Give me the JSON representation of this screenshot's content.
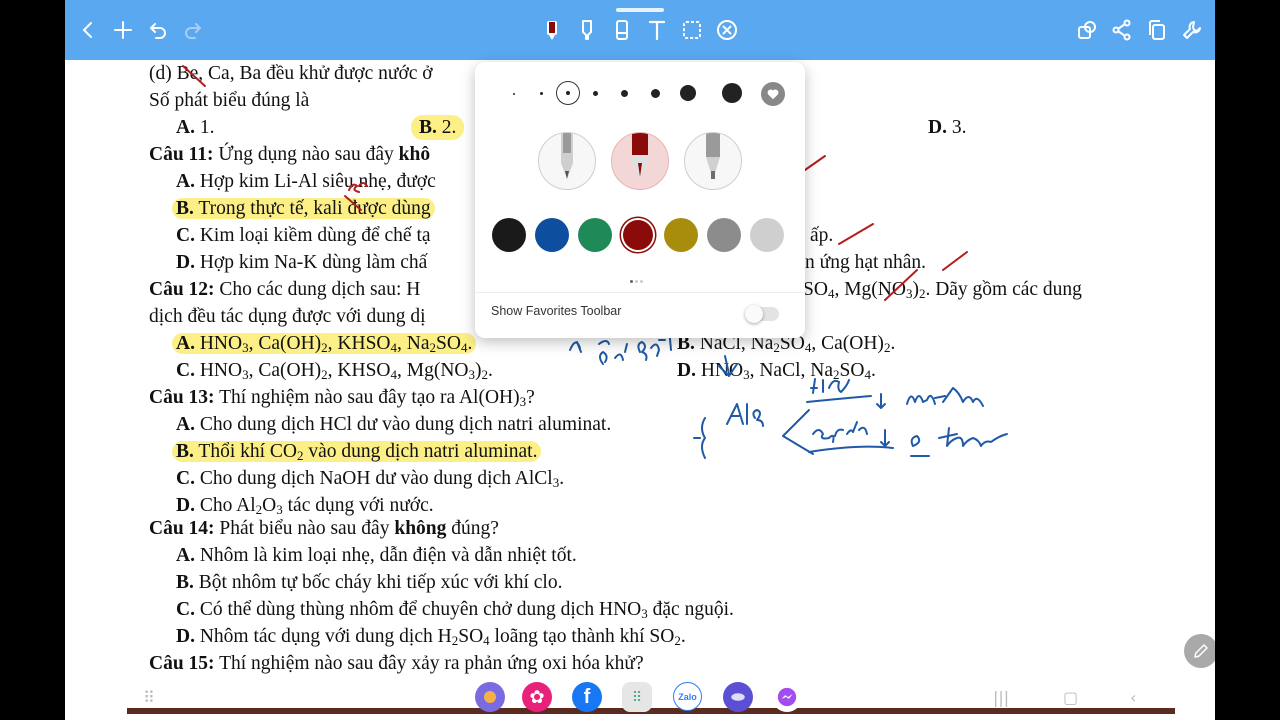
{
  "toolbar": {
    "left_icons": [
      "back-icon",
      "add-icon",
      "undo-icon",
      "redo-icon"
    ],
    "center_icons": [
      "pen-icon",
      "highlighter-icon",
      "eraser-icon",
      "text-icon",
      "lasso-icon",
      "close-circle-icon"
    ],
    "right_icons": [
      "shapes-icon",
      "share-icon",
      "copy-icon",
      "settings-wrench-icon"
    ],
    "accent": "#5aa8ef"
  },
  "doc": {
    "line1": {
      "prefix": "(d) ",
      "struck": "Be",
      ", rest": "",
      "text": ", Ca, Ba đều khử được nước ở"
    },
    "line2": "Số phát biểu đúng là",
    "q10": {
      "a_lbl": "A.",
      "a": "1.",
      "b_lbl": "B.",
      "b": "2.",
      "d_lbl": "D.",
      "d": "3."
    },
    "q11": {
      "label": "Câu 11:",
      "stem": "Ứng dụng nào sau đây",
      "stem_bold": "khô",
      "a_lbl": "A.",
      "a": "Hợp kim Li-Al siêu nhẹ, được",
      "b_lbl": "B.",
      "b": "Trong thực tế, kali được dùng",
      "c_lbl": "C.",
      "c": "Kim loại kiềm dùng để chế tạ",
      "c_tail": "ấp.",
      "d_lbl": "D.",
      "d": "Hợp kim Na-K dùng làm chấ",
      "d_tail": "n ứng hạt nhân."
    },
    "q12": {
      "label": "Câu 12:",
      "stem": "Cho các dung dịch sau: H",
      "stem_tail": "SO",
      "stem_tail2": ", Mg(NO",
      "stem_tail3": ")",
      "stem_tail4": ". Dãy gồm các dung",
      "line2": "dịch đều tác dụng được với dung dị",
      "a_lbl": "A.",
      "a": "HNO",
      "a2": ", Ca(OH)",
      "a3": ", KHSO",
      "a4": ", Na",
      "a5": "SO",
      "a6": ".",
      "b_lbl": "B.",
      "b": "NaCl, Na",
      "b2": "SO",
      "b3": ", Ca(OH)",
      "b4": ".",
      "c_lbl": "C.",
      "c": "HNO",
      "c2": ", Ca(OH)",
      "c3": ", KHSO",
      "c4": ", Mg(NO",
      "c5": ")",
      "c6": ".",
      "d_lbl": "D.",
      "d": "HNO",
      "d2": ", NaCl, Na",
      "d3": "SO",
      "d4": "."
    },
    "q13": {
      "label": "Câu 13:",
      "stem": "Thí nghiệm nào sau đây tạo ra Al(OH)",
      "stem2": "?",
      "a_lbl": "A.",
      "a": "Cho dung dịch HCl dư vào dung dịch natri aluminat.",
      "b_lbl": "B.",
      "b": "Thổi khí CO",
      "b2": " vào dung dịch natri aluminat.",
      "c_lbl": "C.",
      "c": "Cho dung dịch NaOH dư vào dung dịch AlCl",
      "c2": ".",
      "d_lbl": "D.",
      "d": "Cho Al",
      "d2": "O",
      "d3": " tác dụng với nước."
    },
    "q14": {
      "label": "Câu 14:",
      "stem": "Phát biểu nào sau đây",
      "stem_bold": "không",
      "stem2": "đúng?",
      "a_lbl": "A.",
      "a": "Nhôm là kim loại nhẹ, dẫn điện và dẫn nhiệt tốt.",
      "b_lbl": "B.",
      "b": "Bột nhôm tự bốc cháy khi tiếp xúc với khí clo.",
      "c_lbl": "C.",
      "c": "Có thể dùng thùng nhôm để chuyên chở dung dịch HNO",
      "c2": " đặc nguội.",
      "d_lbl": "D.",
      "d": "Nhôm tác dụng với dung dịch H",
      "d2": "SO",
      "d3": " loãng tạo thành khí SO",
      "d4": "."
    },
    "q15": {
      "label": "Câu 15:",
      "stem": "Thí nghiệm nào sau đây xảy ra phản ứng oxi hóa khử?"
    },
    "subs": {
      "two": "2",
      "three": "3",
      "four": "4"
    }
  },
  "popup": {
    "sizes": [
      "size-1",
      "size-2",
      "size-3",
      "size-4",
      "size-5",
      "size-6",
      "size-7",
      "size-8"
    ],
    "pens": [
      "ballpoint-pen-icon",
      "fountain-pen-icon",
      "pencil-icon"
    ],
    "colors": [
      "#1a1a1a",
      "#0d4f9e",
      "#1f8a57",
      "#8b0a0a",
      "#a88c0c",
      "#8c8c8c",
      "#cfcfcf"
    ],
    "selected_color": "#8b0a0a",
    "favorites_label": "Show Favorites Toolbar",
    "favorites_on": false
  },
  "dock": {
    "apps": [
      "galaxy-store-icon",
      "blossom-app-icon",
      "facebook-icon",
      "apps-grid-icon",
      "zalo-icon",
      "internet-icon",
      "messenger-icon"
    ],
    "zalo_label": "Zalo"
  }
}
